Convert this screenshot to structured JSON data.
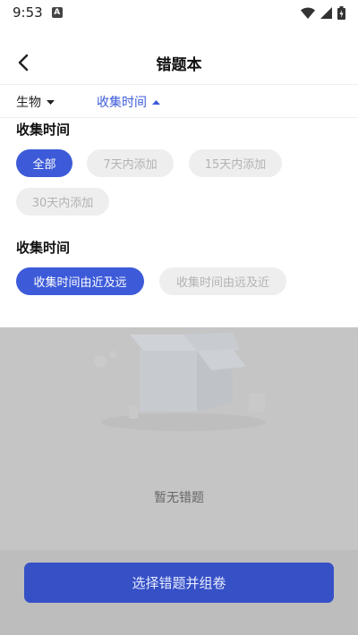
{
  "status_bar": {
    "time": "9:53",
    "notification_badge": "A"
  },
  "header": {
    "title": "错题本"
  },
  "filters": {
    "subject_label": "生物",
    "time_label": "收集时间"
  },
  "time_panel": {
    "section1_title": "收集时间",
    "section1_options": [
      "全部",
      "7天内添加",
      "15天内添加",
      "30天内添加"
    ],
    "section2_title": "收集时间",
    "section2_options": [
      "收集时间由近及远",
      "收集时间由远及近"
    ]
  },
  "empty_state": {
    "text": "暂无错题"
  },
  "bottom": {
    "button_label": "选择错题并组卷"
  },
  "colors": {
    "accent": "#3d5bd9",
    "button": "#3650c6",
    "overlay": "#c5c5c5"
  }
}
